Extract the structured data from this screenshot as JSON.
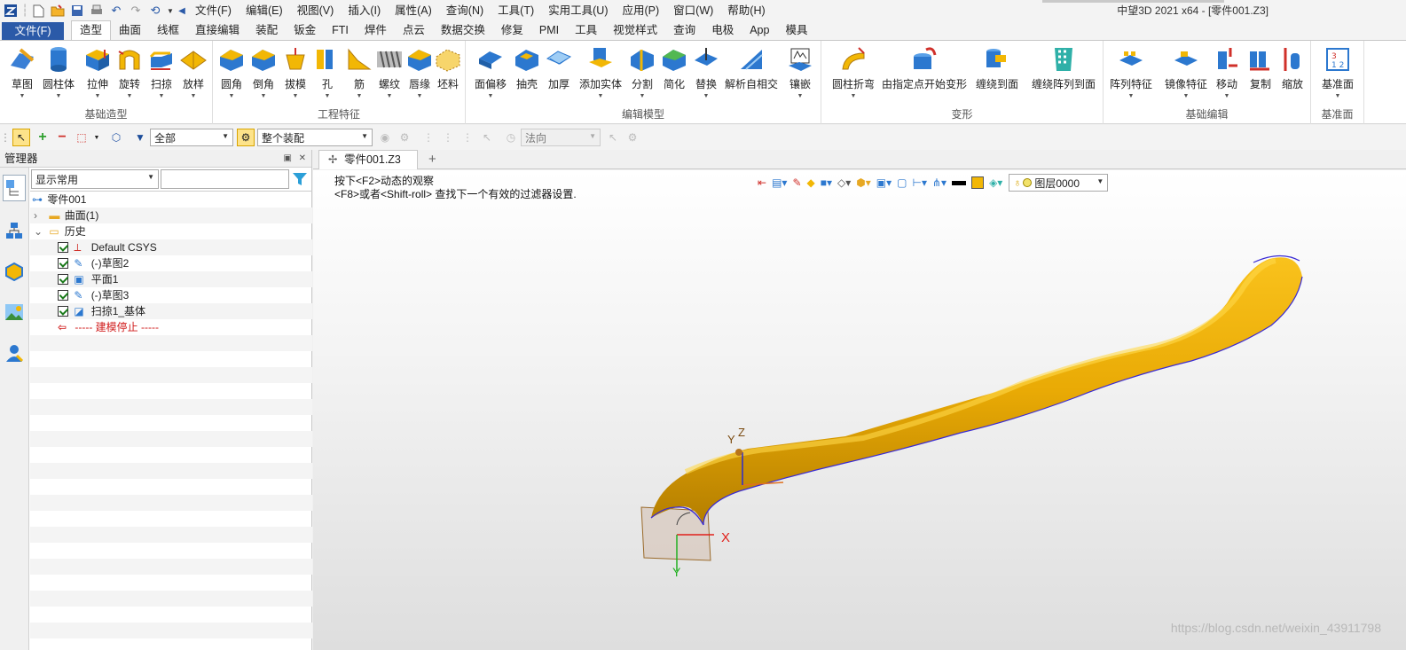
{
  "title_bar": {
    "window_title": "中望3D 2021 x64 - [零件001.Z3]",
    "menus": [
      "文件(F)",
      "编辑(E)",
      "视图(V)",
      "插入(I)",
      "属性(A)",
      "查询(N)",
      "工具(T)",
      "实用工具(U)",
      "应用(P)",
      "窗口(W)",
      "帮助(H)"
    ]
  },
  "ribbon_tabs": {
    "file_tab": "文件(F)",
    "tabs": [
      "造型",
      "曲面",
      "线框",
      "直接编辑",
      "装配",
      "钣金",
      "FTI",
      "焊件",
      "点云",
      "数据交换",
      "修复",
      "PMI",
      "工具",
      "视觉样式",
      "查询",
      "电极",
      "App",
      "模具"
    ],
    "active": "造型"
  },
  "ribbon": {
    "groups": [
      {
        "label": "基础造型",
        "buttons": [
          "草图",
          "圆柱体",
          "拉伸",
          "旋转",
          "扫掠",
          "放样"
        ]
      },
      {
        "label": "工程特征",
        "buttons": [
          "圆角",
          "倒角",
          "拔模",
          "孔",
          "筋",
          "螺纹",
          "唇缘",
          "坯料"
        ]
      },
      {
        "label": "编辑模型",
        "buttons": [
          "面偏移",
          "抽壳",
          "加厚",
          "添加实体",
          "分割",
          "简化",
          "替换",
          "解析自相交",
          "镶嵌"
        ]
      },
      {
        "label": "变形",
        "buttons": [
          "圆柱折弯",
          "由指定点开始变形",
          "缠绕到面",
          "缠绕阵列到面"
        ]
      },
      {
        "label": "基础编辑",
        "buttons": [
          "阵列特征",
          "镜像特征",
          "移动",
          "复制",
          "缩放"
        ]
      },
      {
        "label": "基准面",
        "buttons": [
          "基准面"
        ]
      }
    ]
  },
  "toolbar2": {
    "filter_value": "全部",
    "assembly_value": "整个装配",
    "direction_value": "法向"
  },
  "manager": {
    "title": "管理器",
    "display_combo": "显示常用",
    "search_value": "",
    "tree": [
      {
        "label": "零件001",
        "level": 0
      },
      {
        "label": "曲面(1)",
        "level": 1
      },
      {
        "label": "历史",
        "level": 1
      },
      {
        "label": "Default CSYS",
        "level": 2
      },
      {
        "label": "(-)草图2",
        "level": 2
      },
      {
        "label": "平面1",
        "level": 2
      },
      {
        "label": "(-)草图3",
        "level": 2
      },
      {
        "label": "扫掠1_基体",
        "level": 2
      },
      {
        "label": "----- 建模停止 -----",
        "level": 2
      }
    ]
  },
  "document": {
    "tab_label": "零件001.Z3",
    "tab_close": "✕",
    "new_tab": "+"
  },
  "viewport": {
    "hint_line1": "按下<F2>动态的观察",
    "hint_line2": "<F8>或者<Shift-roll> 查找下一个有效的过滤器设置.",
    "layer_value": "图层0000",
    "axis_x": "X",
    "axis_y": "Y",
    "axis_z": "Z",
    "small_axis_y": "Y",
    "watermark": "https://blog.csdn.net/weixin_43911798",
    "model_color": "#F2B705",
    "edge_color": "#3a2bd4"
  },
  "colors": {
    "accent": "#2B5AA8",
    "stop_marker": "#D01C1C"
  }
}
